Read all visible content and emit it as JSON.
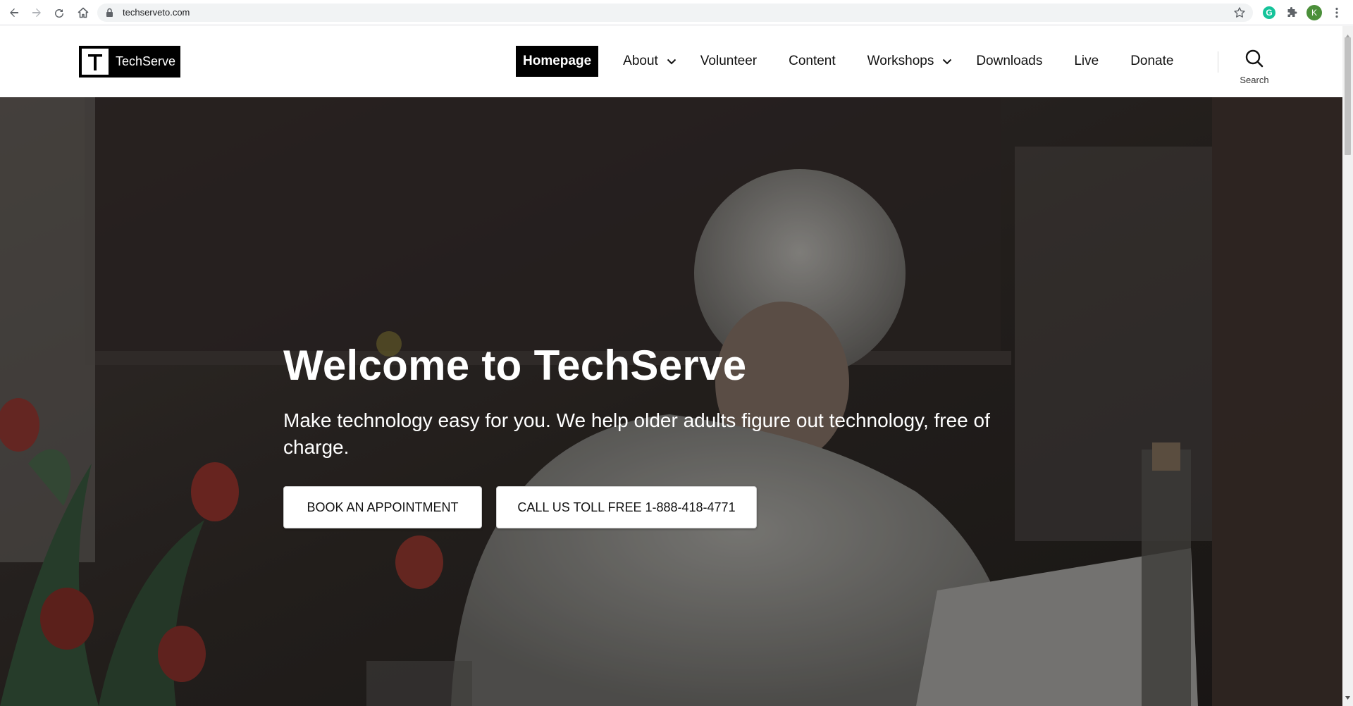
{
  "browser": {
    "url": "techserveto.com",
    "profile_initial": "K",
    "extension_initial": "G"
  },
  "site": {
    "logo_letter": "T",
    "logo_name": "TechServe"
  },
  "nav": {
    "items": [
      {
        "label": "Homepage",
        "current": true,
        "dropdown": false
      },
      {
        "label": "About",
        "current": false,
        "dropdown": true
      },
      {
        "label": "Volunteer",
        "current": false,
        "dropdown": false
      },
      {
        "label": "Content",
        "current": false,
        "dropdown": false
      },
      {
        "label": "Workshops",
        "current": false,
        "dropdown": true
      },
      {
        "label": "Downloads",
        "current": false,
        "dropdown": false
      },
      {
        "label": "Live",
        "current": false,
        "dropdown": false
      },
      {
        "label": "Donate",
        "current": false,
        "dropdown": false
      }
    ],
    "search_label": "Search"
  },
  "hero": {
    "title": "Welcome to TechServe",
    "subtitle": "Make technology easy for you. We help older adults figure out technology, free of charge.",
    "book_button": "BOOK AN APPOINTMENT",
    "call_button": "CALL US TOLL FREE 1-888-418-4771"
  },
  "colors": {
    "nav_current_bg": "#000000",
    "button_bg": "#ffffff",
    "hero_text": "#ffffff",
    "grammarly": "#15c39a",
    "avatar": "#4b8f3a"
  }
}
